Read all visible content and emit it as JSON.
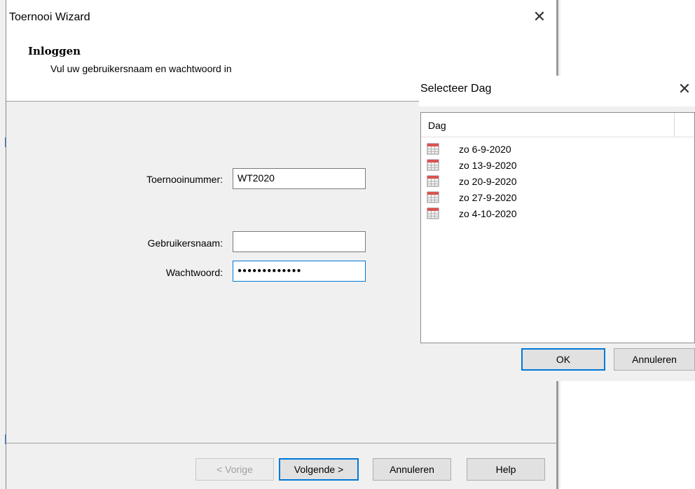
{
  "wizard": {
    "title": "Toernooi Wizard",
    "header_title": "Inloggen",
    "header_subtitle": "Vul uw gebruikersnaam en wachtwoord in",
    "fields": {
      "tournament_label": "Toernooinummer:",
      "tournament_value": "WT2020",
      "username_label": "Gebruikersnaam:",
      "username_value": "",
      "password_label": "Wachtwoord:",
      "password_value": "●●●●●●●●●●●●●"
    },
    "buttons": {
      "back": "< Vorige",
      "next": "Volgende >",
      "cancel": "Annuleren",
      "help": "Help"
    },
    "close_glyph": "✕"
  },
  "day_dialog": {
    "title": "Selecteer Dag",
    "close_glyph": "✕",
    "column_header": "Dag",
    "days": [
      "zo 6-9-2020",
      "zo 13-9-2020",
      "zo 20-9-2020",
      "zo 27-9-2020",
      "zo 4-10-2020"
    ],
    "ok_label": "OK",
    "cancel_label": "Annuleren",
    "icon_name": "calendar-icon",
    "colors": {
      "accent": "#0078d7",
      "calendar_red": "#d9534f"
    }
  }
}
